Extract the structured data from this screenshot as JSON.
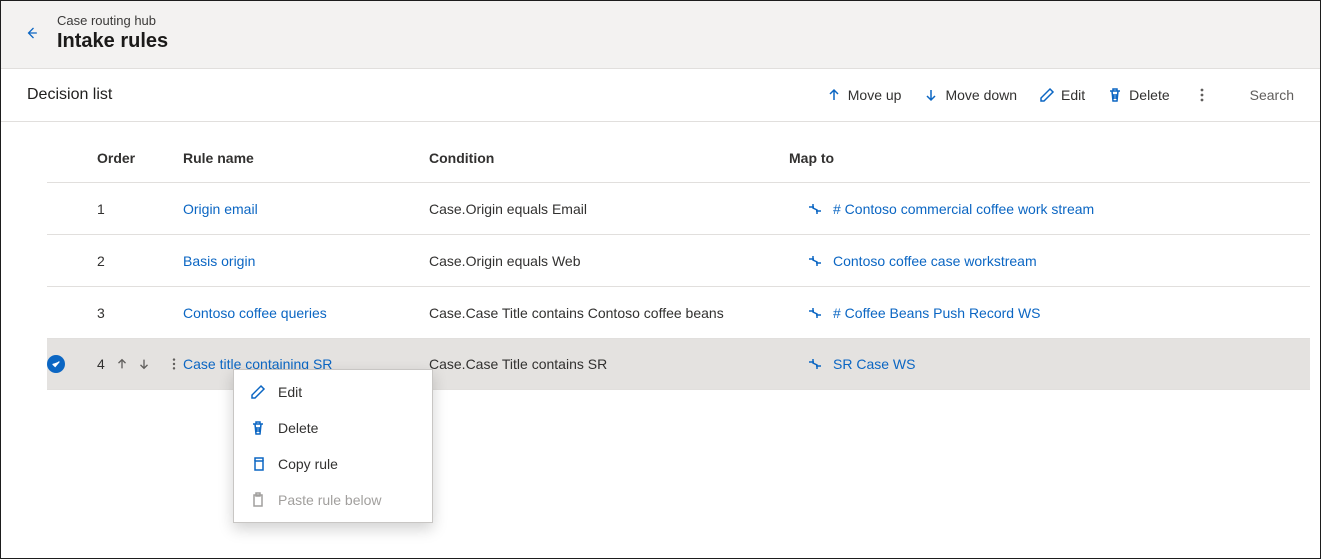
{
  "header": {
    "breadcrumb": "Case routing hub",
    "title": "Intake rules"
  },
  "section": {
    "title": "Decision list"
  },
  "commands": {
    "move_up": "Move up",
    "move_down": "Move down",
    "edit": "Edit",
    "delete": "Delete",
    "search": "Search"
  },
  "columns": {
    "order": "Order",
    "rule_name": "Rule name",
    "condition": "Condition",
    "map_to": "Map to"
  },
  "rows": [
    {
      "order": "1",
      "rule_name": "Origin email",
      "condition": "Case.Origin equals Email",
      "map_to": "# Contoso commercial coffee work stream",
      "selected": false
    },
    {
      "order": "2",
      "rule_name": "Basis origin",
      "condition": "Case.Origin equals Web",
      "map_to": "Contoso coffee case workstream",
      "selected": false
    },
    {
      "order": "3",
      "rule_name": "Contoso coffee queries",
      "condition": "Case.Case Title contains Contoso coffee beans",
      "map_to": "# Coffee Beans Push Record WS",
      "selected": false
    },
    {
      "order": "4",
      "rule_name": "Case title containing SR",
      "condition": "Case.Case Title contains SR",
      "map_to": "SR Case WS",
      "selected": true
    }
  ],
  "context_menu": {
    "edit": "Edit",
    "delete": "Delete",
    "copy": "Copy rule",
    "paste": "Paste rule below"
  }
}
